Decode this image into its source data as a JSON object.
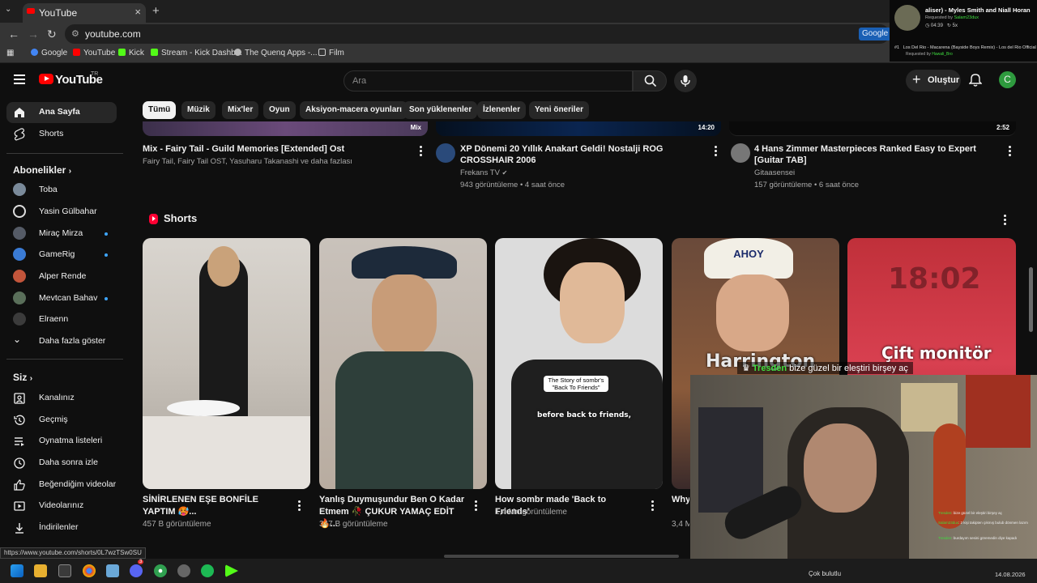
{
  "browser": {
    "tab_title": "YouTube",
    "tab_close": "×",
    "new_tab": "+",
    "address": "youtube.com",
    "google_button": "Google",
    "bookmarks": [
      "Google",
      "YouTube",
      "Kick",
      "Stream - Kick Dashb...",
      "The Quenq Apps -...",
      "Film"
    ]
  },
  "now_playing": {
    "song": "aliser) - Myles Smith and Niall Horan",
    "requested_label": "Requested by",
    "requested_by": "Salam23dux",
    "time": "04:39",
    "plays": "5x",
    "queue_index": "#1",
    "queue_song": "Los Del Rio - Macarena (Bayside Boys Remix) - Los del Rio Official",
    "queue_by": "Hawali_Bro"
  },
  "header": {
    "logo": "YouTube",
    "country": "TR",
    "search_placeholder": "Ara",
    "create_label": "Oluştur",
    "avatar_letter": "C"
  },
  "sidebar": {
    "main": [
      {
        "label": "Ana Sayfa"
      },
      {
        "label": "Shorts"
      }
    ],
    "subs_heading": "Abonelikler",
    "subscriptions": [
      {
        "label": "Toba",
        "color": "#7a8a9a",
        "dot": false
      },
      {
        "label": "Yasin Gülbahar",
        "color": "#dddddd",
        "dot": false
      },
      {
        "label": "Miraç Mirza",
        "color": "#555b66",
        "dot": true
      },
      {
        "label": "GameRig",
        "color": "#3a7bd5",
        "dot": true
      },
      {
        "label": "Alper Rende",
        "color": "#c2553b",
        "dot": false
      },
      {
        "label": "Mevtcan Bahav",
        "color": "#5a6f5a",
        "dot": true
      },
      {
        "label": "Elraenn",
        "color": "#3b3b3b",
        "dot": false
      }
    ],
    "show_more": "Daha fazla göster",
    "you_heading": "Siz",
    "you_items": [
      {
        "label": "Kanalınız"
      },
      {
        "label": "Geçmiş"
      },
      {
        "label": "Oynatma listeleri"
      },
      {
        "label": "Daha sonra izle"
      },
      {
        "label": "Beğendiğim videolar"
      },
      {
        "label": "Videolarınız"
      },
      {
        "label": "İndirilenler"
      }
    ]
  },
  "chips": [
    "Tümü",
    "Müzik",
    "Mix'ler",
    "Oyun",
    "Aksiyon-macera oyunları",
    "Son yüklenenler",
    "İzlenenler",
    "Yeni öneriler"
  ],
  "videos": [
    {
      "title": "Mix - Fairy Tail - Guild Memories [Extended] Ost",
      "channel": "Fairy Tail, Fairy Tail OST, Yasuharu Takanashi ve daha fazlası",
      "stats": "",
      "badge": "Mix"
    },
    {
      "title": "XP Dönemi 20 Yıllık Anakart Geldi! Nostalji ROG CROSSHAIR 2006",
      "channel": "Frekans TV",
      "stats": "943 görüntüleme • 4 saat önce",
      "badge": "14:20"
    },
    {
      "title": "4 Hans Zimmer Masterpieces Ranked Easy to Expert [Guitar TAB]",
      "channel": "Gitaasensei",
      "stats": "157 görüntüleme • 6 saat önce",
      "badge": "2:52"
    }
  ],
  "shorts": {
    "heading": "Shorts",
    "items": [
      {
        "title": "SİNİRLENEN EŞE BONFİLE YAPTIM 🥵...",
        "views": "457 B görüntüleme"
      },
      {
        "title": "Yanlış Duymuşundur Ben O Kadar Etmem 🥀 ÇUKUR YAMAÇ EDİT 🔥...",
        "views": "347 B görüntüleme"
      },
      {
        "title": "How sombr made 'Back to Friends'",
        "views": "1,4 Mn görüntüleme"
      },
      {
        "title": "Why",
        "views": "3,4 M"
      }
    ],
    "caption3a": "The Story of sombr's",
    "caption3b": "\"Back To Friends\"",
    "caption3c": "before back to friends,",
    "caption4": "Harrington",
    "caption4_ahoy": "AHOY",
    "caption5": "Çift monitör",
    "caption5_time": "18:02"
  },
  "stream": {
    "chat_user": "Tresden",
    "chat_text": "bize güzel bir eleştiri birşey aç",
    "mini_chat": [
      {
        "user": "Tresden",
        "text": "bize güzel bir eleştiri birşey aç"
      },
      {
        "user": "Salam23dux",
        "text": "2 kişi takipten çıkmış bulub dönmen lazım"
      },
      {
        "user": "Tresden",
        "text": "burdayım sesini göremedin diye kapadı"
      }
    ]
  },
  "status_url": "https://www.youtube.com/shorts/0L7wzTSw0SU",
  "taskbar": {
    "weather": "Çok bulutlu",
    "date": "14.08.2026",
    "badge": "3"
  }
}
